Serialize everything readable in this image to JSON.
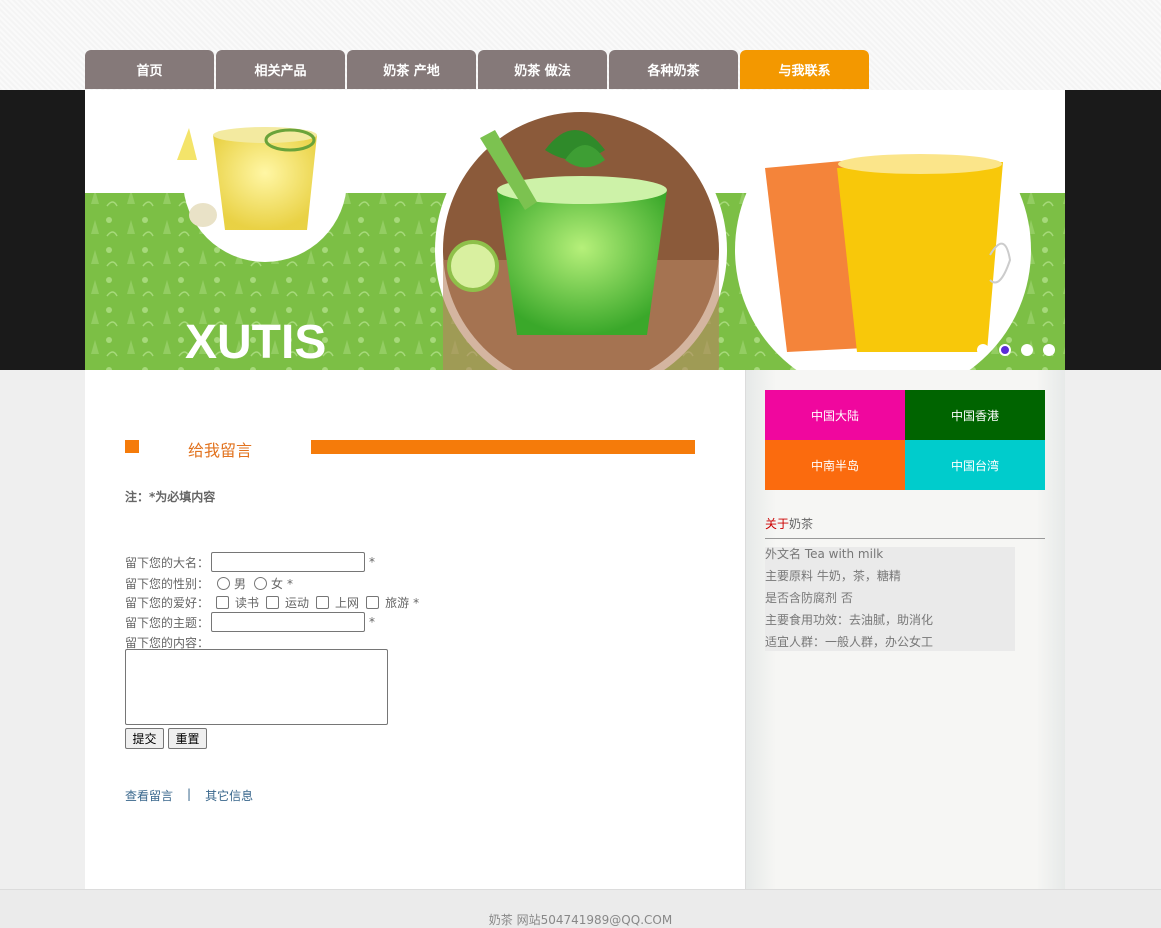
{
  "nav": {
    "items": [
      {
        "label": "首页"
      },
      {
        "label": "相关产品"
      },
      {
        "label": "奶茶 产地"
      },
      {
        "label": "奶茶 做法"
      },
      {
        "label": "各种奶茶"
      },
      {
        "label": "与我联系"
      }
    ],
    "active_index": 5,
    "colors": {
      "default": "#857979",
      "active": "#f39800"
    }
  },
  "banner": {
    "logo_text": "XUTIS",
    "slide_count": 4,
    "active_slide": 2
  },
  "message_section": {
    "title": "给我留言",
    "note": "注：*为必填内容",
    "accent_color": "#f57b0a"
  },
  "form": {
    "name_label": "留下您的大名：",
    "name_value": "",
    "gender_label": "留下您的性别：",
    "gender_options": [
      "男",
      "女"
    ],
    "hobby_label": "留下您的爱好：",
    "hobby_options": [
      "读书",
      "运动",
      "上网",
      "旅游"
    ],
    "subject_label": "留下您的主题：",
    "subject_value": "",
    "content_label": "留下您的内容：",
    "content_value": "",
    "required_mark": "*",
    "submit_label": "提交",
    "reset_label": "重置"
  },
  "links": {
    "view_messages": "查看留言",
    "separator": "|",
    "other_info": "其它信息"
  },
  "regions": [
    {
      "label": "中国大陆",
      "color": "#f0079e"
    },
    {
      "label": "中国香港",
      "color": "#006400"
    },
    {
      "label": "中南半岛",
      "color": "#fb6b0e"
    },
    {
      "label": "中国台湾",
      "color": "#00cccc"
    }
  ],
  "about": {
    "title_highlight": "关于",
    "title_rest": "奶茶",
    "items": [
      "外文名 Tea with milk",
      "主要原料 牛奶，茶，糖精",
      "是否含防腐剂 否",
      "主要食用功效：去油腻，助消化",
      "适宜人群：一般人群，办公女工"
    ]
  },
  "footer": {
    "text": "奶茶 网站504741989@QQ.COM"
  }
}
